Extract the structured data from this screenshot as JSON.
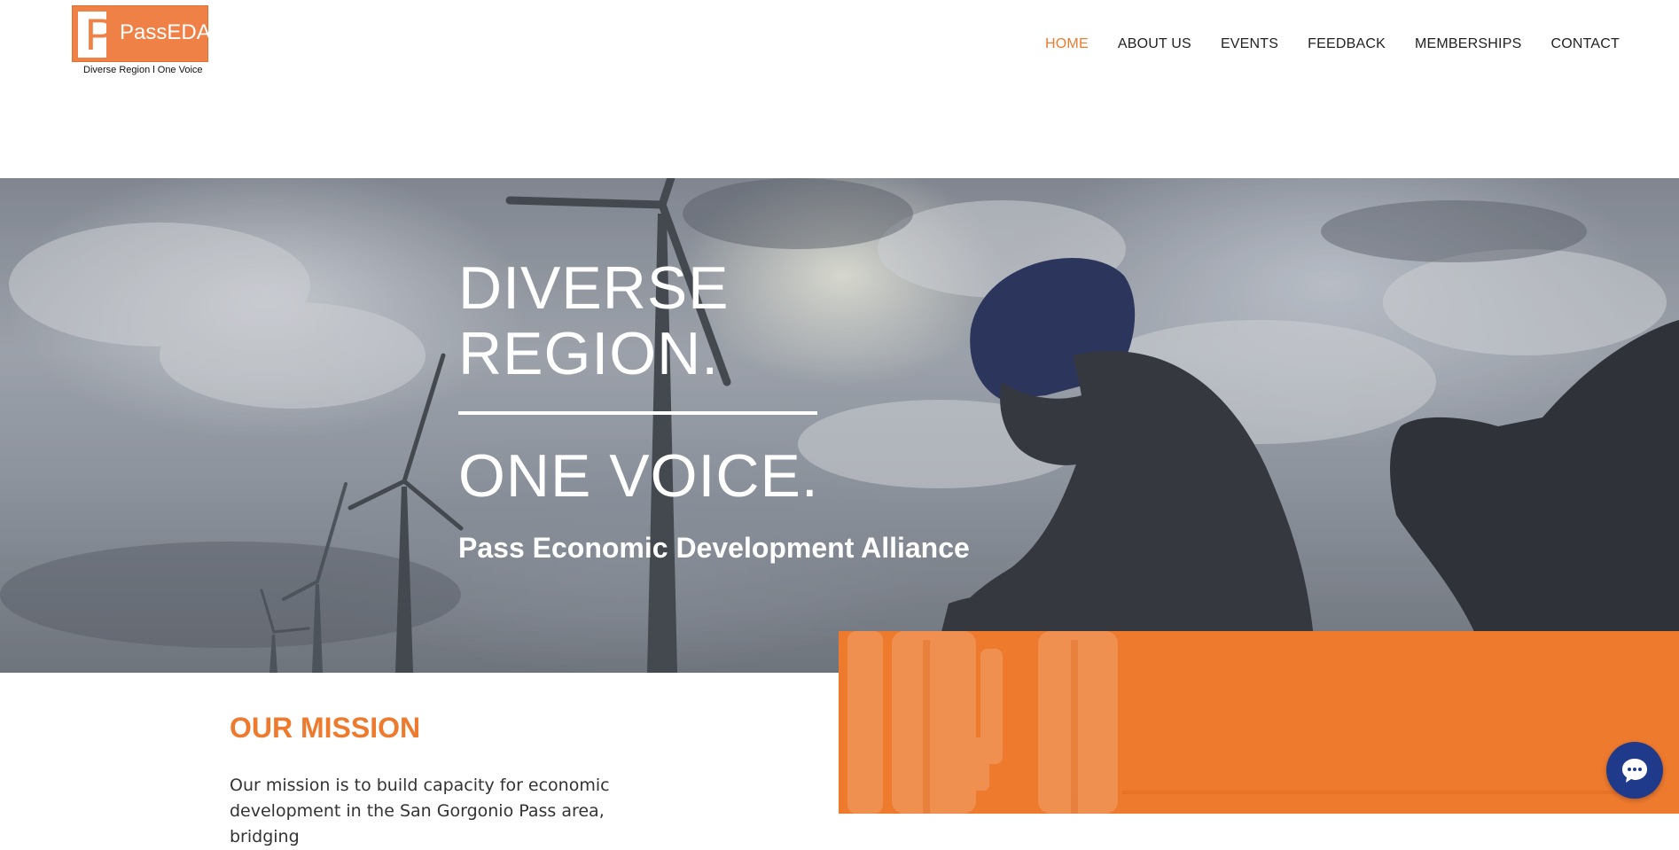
{
  "brand": {
    "logo_letter": "P",
    "name": "PassEDA",
    "tagline": "Diverse Region l One Voice",
    "accent_color": "#ee7a2e"
  },
  "nav": {
    "items": [
      {
        "label": "HOME",
        "active": true
      },
      {
        "label": "ABOUT US",
        "active": false
      },
      {
        "label": "EVENTS",
        "active": false
      },
      {
        "label": "FEEDBACK",
        "active": false
      },
      {
        "label": "MEMBERSHIPS",
        "active": false
      },
      {
        "label": "CONTACT",
        "active": false
      }
    ]
  },
  "hero": {
    "title_line1": "DIVERSE",
    "title_line2": "REGION.",
    "title_line3": "ONE VOICE.",
    "subtitle": "Pass Economic Development Alliance"
  },
  "mission": {
    "heading": "OUR MISSION",
    "text": "Our mission is to build capacity for economic development in the San Gorgonio Pass area, bridging"
  },
  "chat": {
    "icon": "chat-bubble-icon",
    "color": "#1f3a8a"
  }
}
